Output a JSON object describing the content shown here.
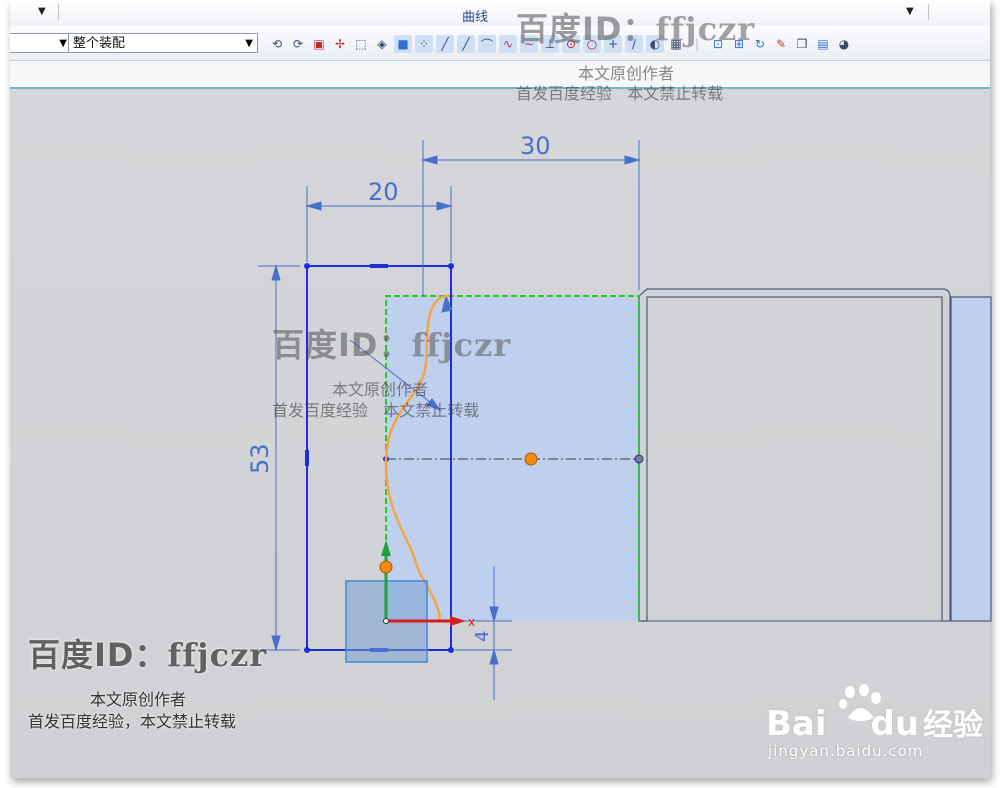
{
  "ribbon": {
    "title": "曲线",
    "left_dropdown_glyph": "▼",
    "right_dropdown_glyph": "▼"
  },
  "toolbar": {
    "select1": {
      "value": ""
    },
    "select2": {
      "value": "整个装配"
    },
    "select_arrow": "▼",
    "icons": [
      "undo-icon",
      "redo-icon",
      "selection-filter-icon",
      "snap-point-icon",
      "box-select-icon",
      "wireframe-icon",
      "shaded-icon",
      "point-icon",
      "line-icon",
      "line-icon-2",
      "arc-icon",
      "spline-icon",
      "studio-spline-icon",
      "offset-icon",
      "circle-icon",
      "circle-2-icon",
      "cross-icon",
      "slash-icon",
      "measure-icon",
      "grid-icon",
      "fit-view-icon",
      "zoom-icon",
      "rotate-icon",
      "paint-icon",
      "layer-icon",
      "display-icon",
      "render-icon"
    ]
  },
  "sketch": {
    "dims": {
      "d30": "30",
      "d20": "20",
      "d53": "53",
      "d4": "4",
      "axis_x": "x"
    }
  },
  "watermark": {
    "id_prefix": "百度ID：",
    "id_name": "ffjczr",
    "line1": "本文原创作者",
    "line2a": "首发百度经验",
    "line2b": "本文禁止转载",
    "line2_full": "首发百度经验，本文禁止转载"
  },
  "branding": {
    "logo_text": "Bai",
    "logo_text2": "du",
    "logo_cn": "经验",
    "url": "jingyan.baidu.com"
  },
  "colors": {
    "sketch_blue": "#1a2fd6",
    "profile_orange": "#f5a442",
    "fill_blue": "#bfcfee",
    "edge_green": "#22cc22",
    "dim_blue": "#4a6fc8"
  }
}
